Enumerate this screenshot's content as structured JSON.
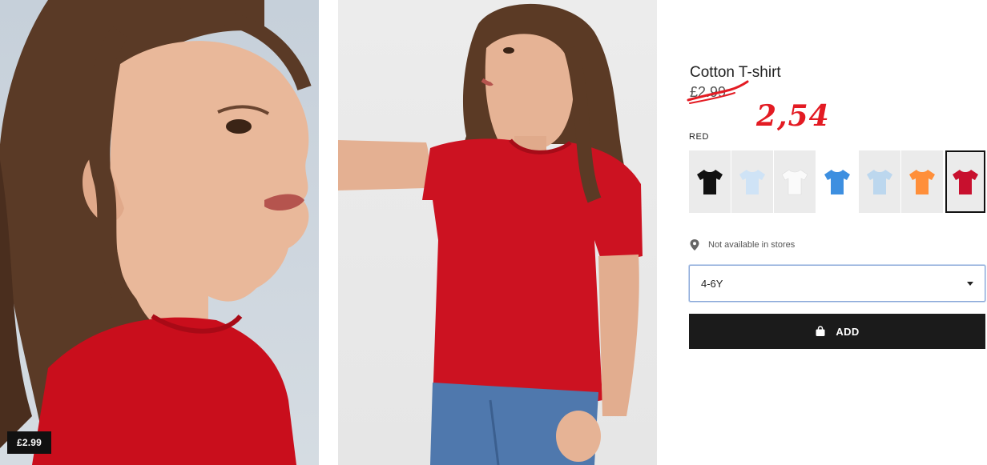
{
  "gallery": {
    "price_tag": "£2.99"
  },
  "product": {
    "title": "Cotton T-shirt",
    "old_price": "£2.99",
    "new_price": "2,54",
    "color_label": "RED",
    "swatches": [
      {
        "name": "black",
        "color": "#111111"
      },
      {
        "name": "light-blue",
        "color": "#cfe3f6"
      },
      {
        "name": "white",
        "color": "#fafafa"
      },
      {
        "name": "blue",
        "color": "#3d8fe0"
      },
      {
        "name": "pale-blue",
        "color": "#bcd7ee"
      },
      {
        "name": "orange",
        "color": "#ff8f3a"
      },
      {
        "name": "red",
        "color": "#c8102e",
        "selected": true
      }
    ],
    "availability": "Not available in stores",
    "size_value": "4-6Y",
    "add_label": "ADD"
  },
  "colors": {
    "annotation_red": "#e31b23",
    "button_dark": "#1b1b1b"
  }
}
